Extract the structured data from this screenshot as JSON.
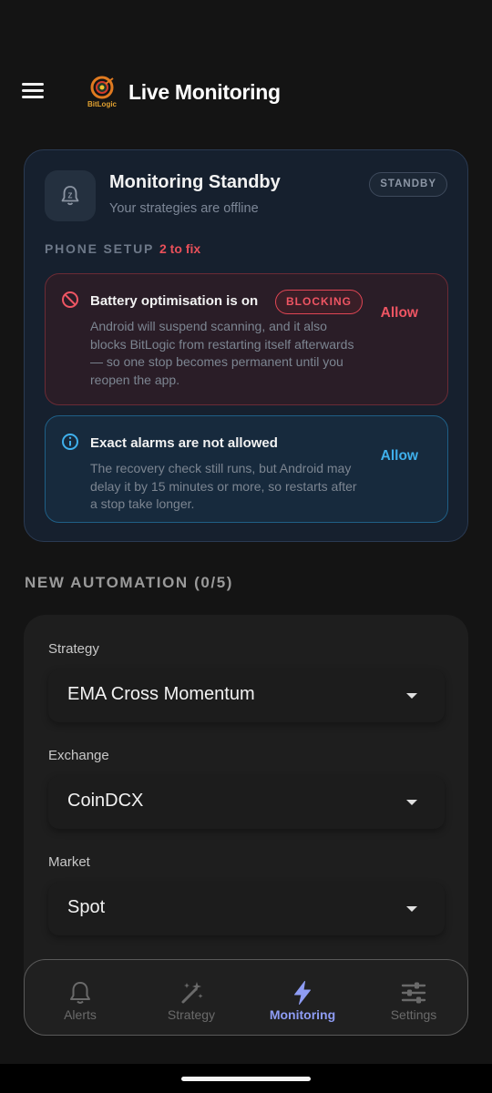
{
  "header": {
    "title": "Live Monitoring",
    "logo_text": "BitLogic"
  },
  "status_card": {
    "title": "Monitoring Standby",
    "subtitle": "Your strategies are offline",
    "badge": "STANDBY",
    "setup_label": "PHONE SETUP",
    "setup_count": "2 to fix",
    "issues": [
      {
        "title": "Battery optimisation is on",
        "badge": "BLOCKING",
        "description": "Android will suspend scanning, and it also blocks BitLogic from restarting itself afterwards — so one stop becomes permanent until you reopen the app.",
        "action": "Allow",
        "color": "#ee5563"
      },
      {
        "title": "Exact alarms are not allowed",
        "description": "The recovery check still runs, but Android may delay it by 15 minutes or more, so restarts after a stop take longer.",
        "action": "Allow",
        "color": "#3fb0ec"
      }
    ]
  },
  "automation": {
    "heading": "NEW AUTOMATION (0/5)",
    "fields": [
      {
        "label": "Strategy",
        "value": "EMA Cross Momentum"
      },
      {
        "label": "Exchange",
        "value": "CoinDCX"
      },
      {
        "label": "Market",
        "value": "Spot"
      }
    ]
  },
  "nav": {
    "items": [
      {
        "label": "Alerts",
        "icon": "bell-icon"
      },
      {
        "label": "Strategy",
        "icon": "magic-wand-icon"
      },
      {
        "label": "Monitoring",
        "icon": "lightning-icon",
        "active": true
      },
      {
        "label": "Settings",
        "icon": "sliders-icon"
      }
    ],
    "active_color": "#8e9cf4"
  }
}
